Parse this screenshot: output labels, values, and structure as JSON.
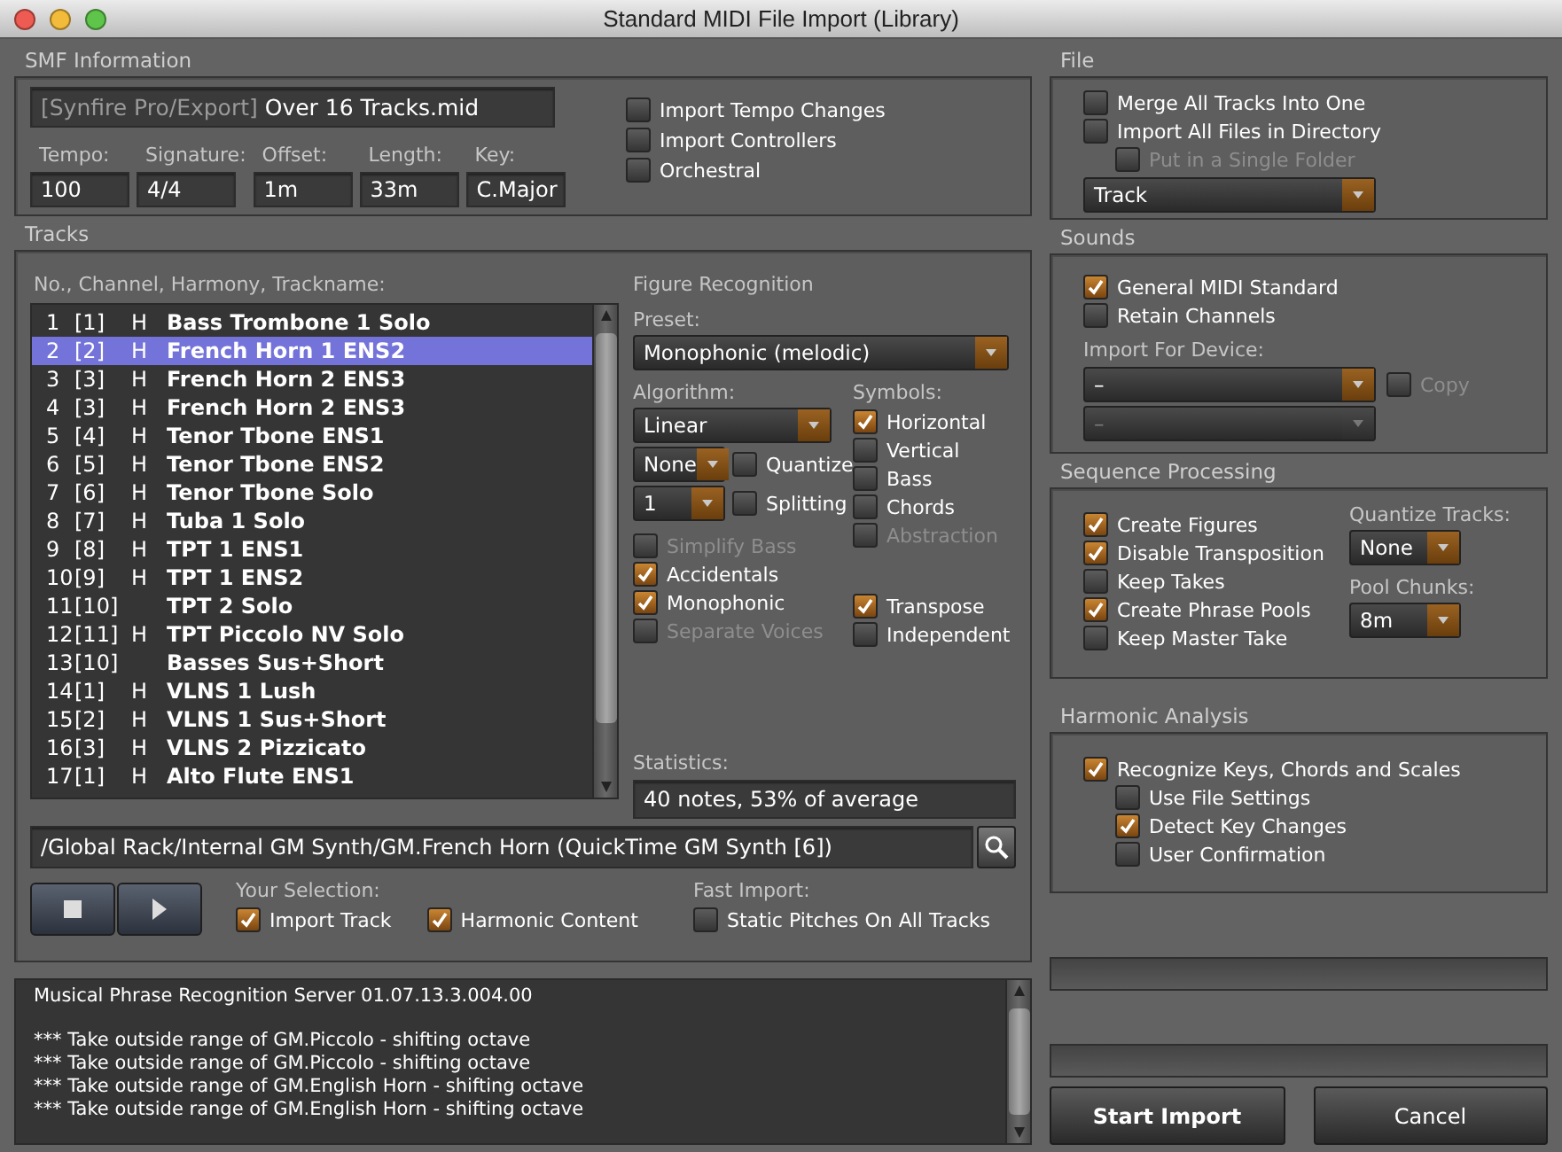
{
  "window": {
    "title": "Standard MIDI File Import (Library)"
  },
  "smf": {
    "title": "SMF Information",
    "file_prefix": "[Synfire Pro/Export]",
    "file_name": "Over 16 Tracks.mid",
    "fields": [
      {
        "label": "Tempo:",
        "value": "100"
      },
      {
        "label": "Signature:",
        "value": "4/4"
      },
      {
        "label": "Offset:",
        "value": "1m"
      },
      {
        "label": "Length:",
        "value": "33m"
      },
      {
        "label": "Key:",
        "value": "C.Major"
      }
    ],
    "options": [
      {
        "label": "Import Tempo Changes",
        "checked": false
      },
      {
        "label": "Import Controllers",
        "checked": false
      },
      {
        "label": "Orchestral",
        "checked": false
      }
    ]
  },
  "tracks": {
    "title": "Tracks",
    "list_header": "No., Channel, Harmony, Trackname:",
    "rows": [
      {
        "number": "1",
        "channel": "[1]",
        "harmony": "H",
        "name": "Bass Trombone 1 Solo",
        "selected": false
      },
      {
        "number": "2",
        "channel": "[2]",
        "harmony": "H",
        "name": "French Horn 1 ENS2",
        "selected": true
      },
      {
        "number": "3",
        "channel": "[3]",
        "harmony": "H",
        "name": "French Horn 2 ENS3",
        "selected": false
      },
      {
        "number": "4",
        "channel": "[3]",
        "harmony": "H",
        "name": "French Horn 2 ENS3",
        "selected": false
      },
      {
        "number": "5",
        "channel": "[4]",
        "harmony": "H",
        "name": "Tenor Tbone ENS1",
        "selected": false
      },
      {
        "number": "6",
        "channel": "[5]",
        "harmony": "H",
        "name": "Tenor Tbone ENS2",
        "selected": false
      },
      {
        "number": "7",
        "channel": "[6]",
        "harmony": "H",
        "name": "Tenor Tbone Solo",
        "selected": false
      },
      {
        "number": "8",
        "channel": "[7]",
        "harmony": "H",
        "name": "Tuba 1 Solo",
        "selected": false
      },
      {
        "number": "9",
        "channel": "[8]",
        "harmony": "H",
        "name": "TPT 1 ENS1",
        "selected": false
      },
      {
        "number": "10",
        "channel": "[9]",
        "harmony": "H",
        "name": "TPT 1 ENS2",
        "selected": false
      },
      {
        "number": "11",
        "channel": "[10]",
        "name": "TPT 2 Solo",
        "selected": false
      },
      {
        "number": "12",
        "channel": "[11]",
        "harmony": "H",
        "name": "TPT Piccolo NV Solo",
        "selected": false
      },
      {
        "number": "13",
        "channel": "[10]",
        "name": "Basses Sus+Short",
        "selected": false
      },
      {
        "number": "14",
        "channel": "[1]",
        "harmony": "H",
        "name": "VLNS 1 Lush",
        "selected": false
      },
      {
        "number": "15",
        "channel": "[2]",
        "harmony": "H",
        "name": "VLNS 1 Sus+Short",
        "selected": false
      },
      {
        "number": "16",
        "channel": "[3]",
        "harmony": "H",
        "name": "VLNS 2 Pizzicato",
        "selected": false
      },
      {
        "number": "17",
        "channel": "[1]",
        "harmony": "H",
        "name": "Alto Flute ENS1",
        "selected": false
      }
    ],
    "figure": {
      "title": "Figure Recognition",
      "preset_label": "Preset:",
      "preset": "Monophonic (melodic)",
      "algorithm_label": "Algorithm:",
      "algorithm": "Linear",
      "quantize": {
        "value": "None",
        "label": "Quantize",
        "checked": false
      },
      "splitting": {
        "value": "1",
        "label": "Splitting",
        "checked": false
      },
      "options": [
        {
          "label": "Simplify Bass",
          "checked": false,
          "disabled": true
        },
        {
          "label": "Accidentals",
          "checked": true,
          "disabled": false
        },
        {
          "label": "Monophonic",
          "checked": true,
          "disabled": false
        },
        {
          "label": "Separate Voices",
          "checked": false,
          "disabled": true
        }
      ],
      "symbols_label": "Symbols:",
      "symbols": [
        {
          "label": "Horizontal",
          "checked": true,
          "disabled": false
        },
        {
          "label": "Vertical",
          "checked": false,
          "disabled": false
        },
        {
          "label": "Bass",
          "checked": false,
          "disabled": false
        },
        {
          "label": "Chords",
          "checked": false,
          "disabled": false
        },
        {
          "label": "Abstraction",
          "checked": false,
          "disabled": true
        }
      ],
      "symbol_options": [
        {
          "label": "Transpose",
          "checked": true
        },
        {
          "label": "Independent",
          "checked": false
        }
      ]
    },
    "statistics_label": "Statistics:",
    "statistics": "40 notes, 53% of average",
    "device_path": "/Global Rack/Internal GM Synth/GM.French Horn  (QuickTime GM Synth  [6])",
    "selection_label": "Your Selection:",
    "selection": [
      {
        "label": "Import Track",
        "checked": true
      },
      {
        "label": "Harmonic Content",
        "checked": true
      }
    ],
    "fast_label": "Fast Import:",
    "fast": [
      {
        "label": "Static Pitches On All Tracks",
        "checked": false
      }
    ]
  },
  "log": {
    "header": "Musical Phrase Recognition Server 01.07.13.3.004.00",
    "lines": [
      "*** Take outside range of GM.Piccolo - shifting octave",
      "*** Take outside range of GM.Piccolo - shifting octave",
      "*** Take outside range of GM.English Horn - shifting octave",
      "*** Take outside range of GM.English Horn - shifting octave"
    ]
  },
  "file": {
    "title": "File",
    "options": [
      {
        "label": "Merge All Tracks Into One",
        "checked": false,
        "disabled": false
      },
      {
        "label": "Import All Files in Directory",
        "checked": false,
        "disabled": false,
        "children": [
          {
            "label": "Put in a Single Folder",
            "checked": false,
            "disabled": true
          }
        ]
      }
    ],
    "mode": "Track"
  },
  "sounds": {
    "title": "Sounds",
    "options": [
      {
        "label": "General MIDI Standard",
        "checked": true
      },
      {
        "label": "Retain Channels",
        "checked": false
      }
    ],
    "device_label": "Import For Device:",
    "device": {
      "value": "–",
      "disabled": false
    },
    "device_secondary": {
      "value": "–",
      "disabled": true
    },
    "copy": {
      "label": "Copy",
      "checked": false,
      "disabled": true
    }
  },
  "sequence": {
    "title": "Sequence Processing",
    "options": [
      {
        "label": "Create Figures",
        "checked": true
      },
      {
        "label": "Disable Transposition",
        "checked": true
      },
      {
        "label": "Keep Takes",
        "checked": false
      },
      {
        "label": "Create Phrase Pools",
        "checked": true
      },
      {
        "label": "Keep Master Take",
        "checked": false
      }
    ],
    "quantize_label": "Quantize Tracks:",
    "quantize": "None",
    "pool_label": "Pool Chunks:",
    "pool": "8m"
  },
  "harmonic": {
    "title": "Harmonic Analysis",
    "options": [
      {
        "label": "Recognize Keys, Chords and Scales",
        "checked": true,
        "children": [
          {
            "label": "Use File Settings",
            "checked": false
          },
          {
            "label": "Detect Key Changes",
            "checked": true
          },
          {
            "label": "User Confirmation",
            "checked": false
          }
        ]
      }
    ]
  },
  "buttons": [
    {
      "label": "Start Import",
      "kind": "primary"
    },
    {
      "label": "Cancel",
      "kind": "cancel"
    }
  ]
}
